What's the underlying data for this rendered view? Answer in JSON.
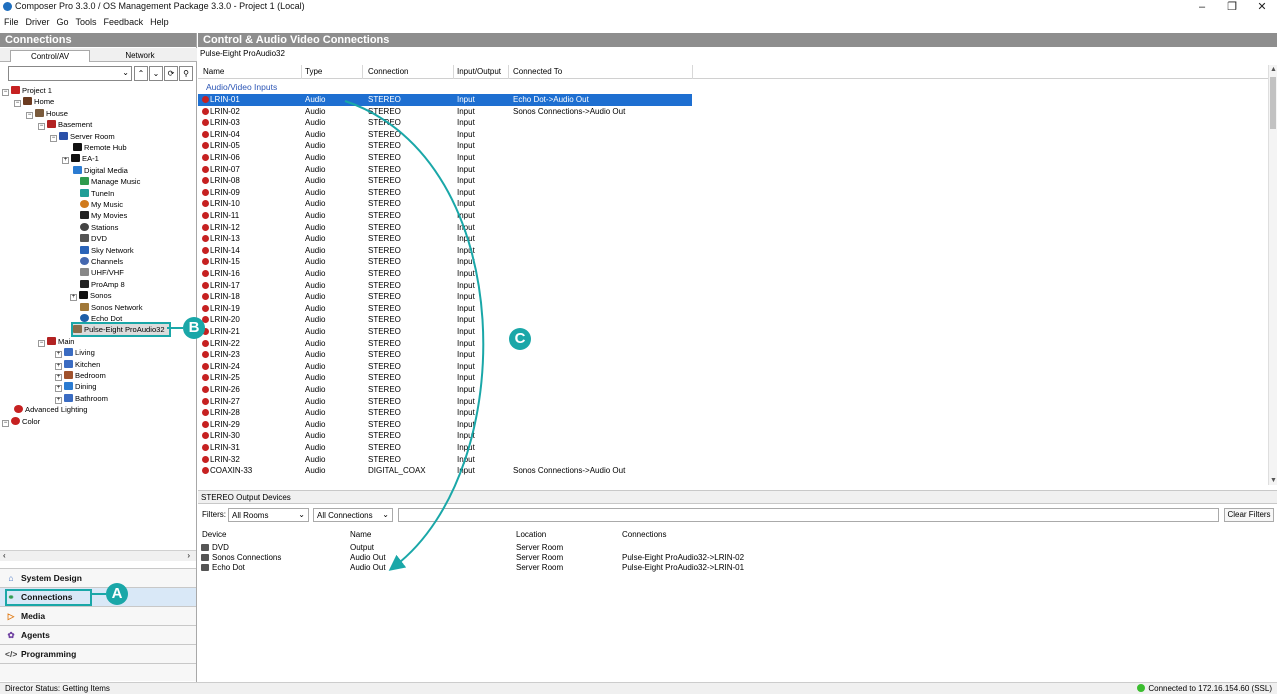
{
  "window": {
    "title": "Composer Pro 3.3.0 / OS Management Package 3.3.0 - Project 1 (Local)",
    "minimize": "–",
    "maximize": "❐",
    "close": "✕"
  },
  "menu": [
    "File",
    "Driver",
    "Go",
    "Tools",
    "Feedback",
    "Help"
  ],
  "left_panel": {
    "header": "Connections",
    "tabs": [
      "Control/AV",
      "Network"
    ],
    "tree": [
      {
        "label": "Project 1",
        "color": "#c62121"
      },
      {
        "label": "Home",
        "color": "#6b3a1f"
      },
      {
        "label": "House",
        "color": "#7a5b3c"
      },
      {
        "label": "Basement",
        "color": "#b22222"
      },
      {
        "label": "Server Room",
        "color": "#2a50a8"
      },
      {
        "label": "Remote Hub",
        "color": "#111111"
      },
      {
        "label": "EA-1",
        "color": "#111111"
      },
      {
        "label": "Digital Media",
        "color": "#2b7bd1"
      },
      {
        "label": "Manage Music",
        "color": "#2e9b4d"
      },
      {
        "label": "TuneIn",
        "color": "#1f9e97"
      },
      {
        "label": "My Music",
        "color": "#d07a1c"
      },
      {
        "label": "My Movies",
        "color": "#222222"
      },
      {
        "label": "Stations",
        "color": "#444444"
      },
      {
        "label": "DVD",
        "color": "#555555"
      },
      {
        "label": "Sky Network",
        "color": "#2a63b8"
      },
      {
        "label": "Channels",
        "color": "#4568b0"
      },
      {
        "label": "UHF/VHF",
        "color": "#888888"
      },
      {
        "label": "ProAmp 8",
        "color": "#222222"
      },
      {
        "label": "Sonos",
        "color": "#111111"
      },
      {
        "label": "Sonos Network",
        "color": "#a07838"
      },
      {
        "label": "Echo Dot",
        "color": "#1e5fa8"
      },
      {
        "label": "Pulse-Eight ProAudio32",
        "color": "#8a6d4a"
      },
      {
        "label": "Main",
        "color": "#b22222"
      },
      {
        "label": "Living",
        "color": "#3b6cc2"
      },
      {
        "label": "Kitchen",
        "color": "#3b6cc2"
      },
      {
        "label": "Bedroom",
        "color": "#a0522d"
      },
      {
        "label": "Dining",
        "color": "#2b7bd1"
      },
      {
        "label": "Bathroom",
        "color": "#3b6cc2"
      },
      {
        "label": "Advanced Lighting",
        "color": "#c62121"
      },
      {
        "label": "Color",
        "color": "#c62121"
      }
    ],
    "nav": [
      {
        "label": "System Design",
        "icon": "⌂"
      },
      {
        "label": "Connections",
        "icon": "⚭"
      },
      {
        "label": "Media",
        "icon": "▷"
      },
      {
        "label": "Agents",
        "icon": "✿"
      },
      {
        "label": "Programming",
        "icon": "</>"
      }
    ]
  },
  "main": {
    "header": "Control & Audio Video Connections",
    "device": "Pulse-Eight ProAudio32",
    "columns": [
      "Name",
      "Type",
      "Connection",
      "Input/Output",
      "Connected To"
    ],
    "group": "Audio/Video Inputs",
    "rows": [
      {
        "name": "LRIN-01",
        "type": "Audio",
        "connection": "STEREO",
        "io": "Input",
        "to": "Echo Dot->Audio Out"
      },
      {
        "name": "LRIN-02",
        "type": "Audio",
        "connection": "STEREO",
        "io": "Input",
        "to": "Sonos Connections->Audio Out"
      },
      {
        "name": "LRIN-03",
        "type": "Audio",
        "connection": "STEREO",
        "io": "Input",
        "to": ""
      },
      {
        "name": "LRIN-04",
        "type": "Audio",
        "connection": "STEREO",
        "io": "Input",
        "to": ""
      },
      {
        "name": "LRIN-05",
        "type": "Audio",
        "connection": "STEREO",
        "io": "Input",
        "to": ""
      },
      {
        "name": "LRIN-06",
        "type": "Audio",
        "connection": "STEREO",
        "io": "Input",
        "to": ""
      },
      {
        "name": "LRIN-07",
        "type": "Audio",
        "connection": "STEREO",
        "io": "Input",
        "to": ""
      },
      {
        "name": "LRIN-08",
        "type": "Audio",
        "connection": "STEREO",
        "io": "Input",
        "to": ""
      },
      {
        "name": "LRIN-09",
        "type": "Audio",
        "connection": "STEREO",
        "io": "Input",
        "to": ""
      },
      {
        "name": "LRIN-10",
        "type": "Audio",
        "connection": "STEREO",
        "io": "Input",
        "to": ""
      },
      {
        "name": "LRIN-11",
        "type": "Audio",
        "connection": "STEREO",
        "io": "Input",
        "to": ""
      },
      {
        "name": "LRIN-12",
        "type": "Audio",
        "connection": "STEREO",
        "io": "Input",
        "to": ""
      },
      {
        "name": "LRIN-13",
        "type": "Audio",
        "connection": "STEREO",
        "io": "Input",
        "to": ""
      },
      {
        "name": "LRIN-14",
        "type": "Audio",
        "connection": "STEREO",
        "io": "Input",
        "to": ""
      },
      {
        "name": "LRIN-15",
        "type": "Audio",
        "connection": "STEREO",
        "io": "Input",
        "to": ""
      },
      {
        "name": "LRIN-16",
        "type": "Audio",
        "connection": "STEREO",
        "io": "Input",
        "to": ""
      },
      {
        "name": "LRIN-17",
        "type": "Audio",
        "connection": "STEREO",
        "io": "Input",
        "to": ""
      },
      {
        "name": "LRIN-18",
        "type": "Audio",
        "connection": "STEREO",
        "io": "Input",
        "to": ""
      },
      {
        "name": "LRIN-19",
        "type": "Audio",
        "connection": "STEREO",
        "io": "Input",
        "to": ""
      },
      {
        "name": "LRIN-20",
        "type": "Audio",
        "connection": "STEREO",
        "io": "Input",
        "to": ""
      },
      {
        "name": "LRIN-21",
        "type": "Audio",
        "connection": "STEREO",
        "io": "Input",
        "to": ""
      },
      {
        "name": "LRIN-22",
        "type": "Audio",
        "connection": "STEREO",
        "io": "Input",
        "to": ""
      },
      {
        "name": "LRIN-23",
        "type": "Audio",
        "connection": "STEREO",
        "io": "Input",
        "to": ""
      },
      {
        "name": "LRIN-24",
        "type": "Audio",
        "connection": "STEREO",
        "io": "Input",
        "to": ""
      },
      {
        "name": "LRIN-25",
        "type": "Audio",
        "connection": "STEREO",
        "io": "Input",
        "to": ""
      },
      {
        "name": "LRIN-26",
        "type": "Audio",
        "connection": "STEREO",
        "io": "Input",
        "to": ""
      },
      {
        "name": "LRIN-27",
        "type": "Audio",
        "connection": "STEREO",
        "io": "Input",
        "to": ""
      },
      {
        "name": "LRIN-28",
        "type": "Audio",
        "connection": "STEREO",
        "io": "Input",
        "to": ""
      },
      {
        "name": "LRIN-29",
        "type": "Audio",
        "connection": "STEREO",
        "io": "Input",
        "to": ""
      },
      {
        "name": "LRIN-30",
        "type": "Audio",
        "connection": "STEREO",
        "io": "Input",
        "to": ""
      },
      {
        "name": "LRIN-31",
        "type": "Audio",
        "connection": "STEREO",
        "io": "Input",
        "to": ""
      },
      {
        "name": "LRIN-32",
        "type": "Audio",
        "connection": "STEREO",
        "io": "Input",
        "to": ""
      },
      {
        "name": "COAXIN-33",
        "type": "Audio",
        "connection": "DIGITAL_COAX",
        "io": "Input",
        "to": "Sonos Connections->Audio Out"
      }
    ]
  },
  "outputs": {
    "title": "STEREO Output Devices",
    "filters_label": "Filters:",
    "room_filter": "All Rooms",
    "connection_filter": "All Connections",
    "search_value": "",
    "clear_label": "Clear Filters",
    "columns": [
      "Device",
      "Name",
      "Location",
      "Connections"
    ],
    "rows": [
      {
        "device": "DVD",
        "name": "Output",
        "location": "Server Room",
        "connections": ""
      },
      {
        "device": "Sonos Connections",
        "name": "Audio Out",
        "location": "Server Room",
        "connections": "Pulse-Eight ProAudio32->LRIN-02"
      },
      {
        "device": "Echo Dot",
        "name": "Audio Out",
        "location": "Server Room",
        "connections": "Pulse-Eight ProAudio32->LRIN-01"
      }
    ]
  },
  "status": {
    "left": "Director Status: Getting Items",
    "right": "Connected to 172.16.154.60 (SSL)"
  },
  "callouts": {
    "a": "A",
    "b": "B",
    "c": "C"
  },
  "colors": {
    "accent": "#1aa7a8",
    "selection": "#1e6fd1",
    "header_bg": "#8e8e8e"
  }
}
